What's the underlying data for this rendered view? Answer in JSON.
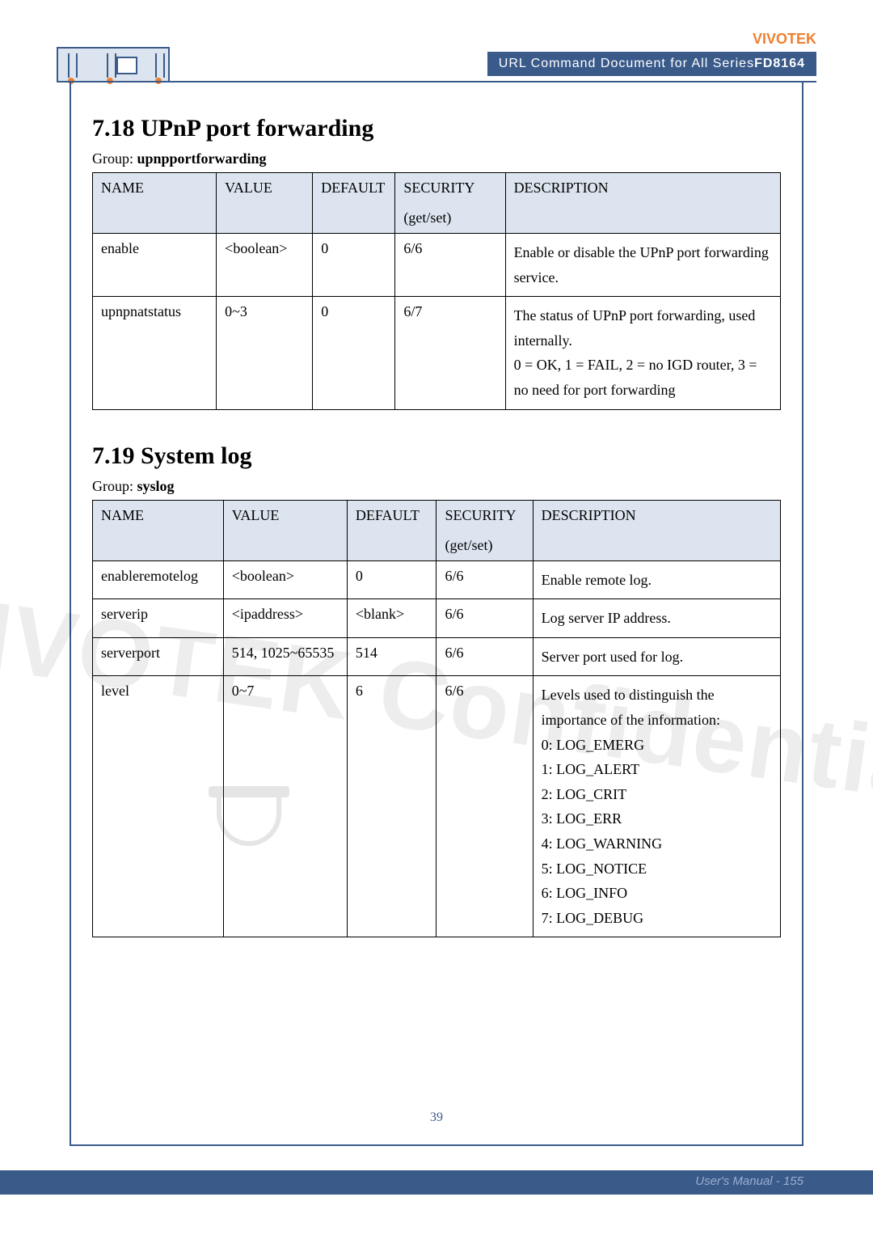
{
  "header": {
    "brand": "VIVOTEK",
    "subtitle_prefix": "URL Command Document for All Series",
    "model": "FD8164"
  },
  "sections": {
    "upnp": {
      "number_title": "7.18 UPnP port forwarding",
      "group_prefix": "Group: ",
      "group_name": "upnpportforwarding",
      "columns": {
        "name": "NAME",
        "value": "VALUE",
        "default": "DEFAULT",
        "security": "SECURITY",
        "security_sub": "(get/set)",
        "description": "DESCRIPTION"
      },
      "rows": [
        {
          "name": "enable",
          "value": "<boolean>",
          "default": "0",
          "security": "6/6",
          "description": "Enable or disable the UPnP port forwarding service."
        },
        {
          "name": "upnpnatstatus",
          "value": "0~3",
          "default": "0",
          "security": "6/7",
          "description": "The status of UPnP port forwarding, used internally.\n0 = OK, 1 = FAIL, 2 = no IGD router, 3 = no need for port forwarding"
        }
      ]
    },
    "syslog": {
      "number_title": "7.19 System log",
      "group_prefix": "Group: ",
      "group_name": "syslog",
      "columns": {
        "name": "NAME",
        "value": "VALUE",
        "default": "DEFAULT",
        "security": "SECURITY",
        "security_sub": "(get/set)",
        "description": "DESCRIPTION"
      },
      "rows": [
        {
          "name": "enableremotelog",
          "value": "<boolean>",
          "default": "0",
          "security": "6/6",
          "description": "Enable remote log."
        },
        {
          "name": "serverip",
          "value": "<ipaddress>",
          "default": "<blank>",
          "security": "6/6",
          "description": "Log server IP address."
        },
        {
          "name": "serverport",
          "value": "514, 1025~65535",
          "default": "514",
          "security": "6/6",
          "description": "Server port used for log."
        },
        {
          "name": "level",
          "value": "0~7",
          "default": "6",
          "security": "6/6",
          "description": "Levels used to distinguish the importance of the information:\n0: LOG_EMERG\n1: LOG_ALERT\n2: LOG_CRIT\n3: LOG_ERR\n4: LOG_WARNING\n5: LOG_NOTICE\n6: LOG_INFO\n7: LOG_DEBUG"
        }
      ]
    }
  },
  "footer": {
    "inner_page": "39",
    "manual_page": "User's Manual - 155"
  },
  "watermark": "VIVOTEK Confidential"
}
